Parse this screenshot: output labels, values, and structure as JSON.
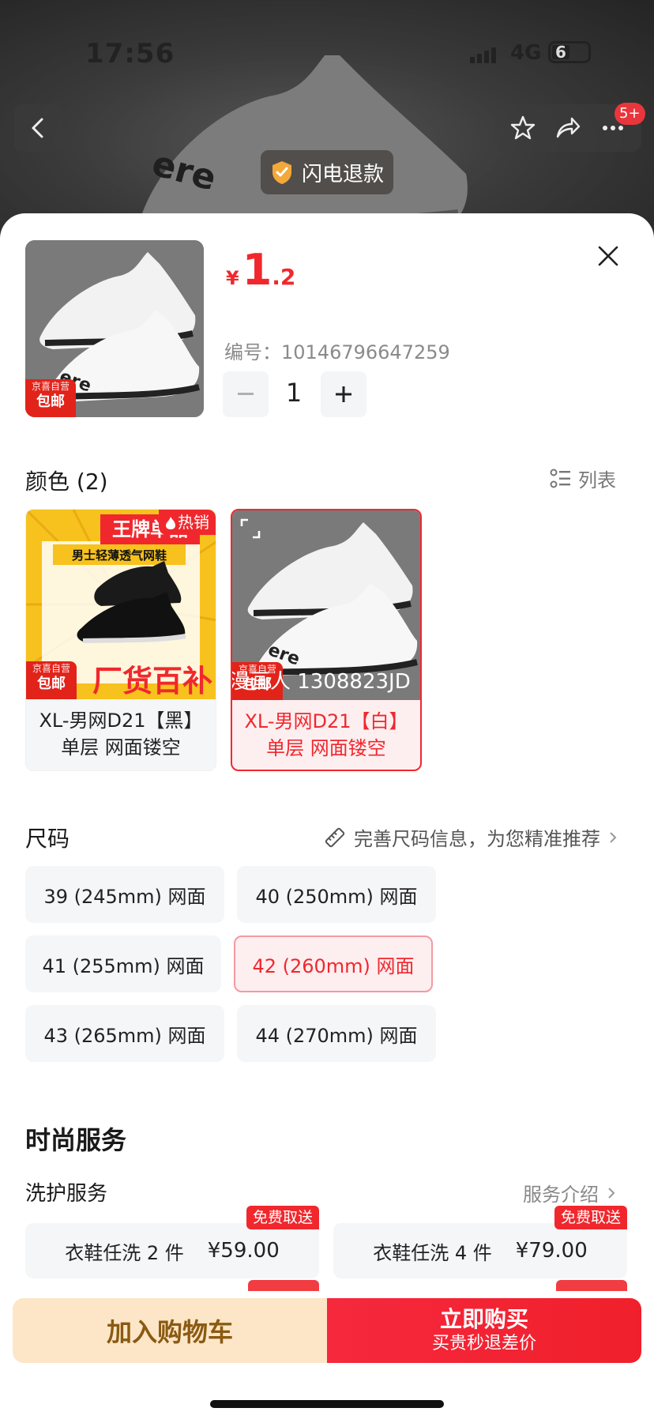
{
  "status_bar": {
    "time": "17:56",
    "network": "4G",
    "battery": "6"
  },
  "top_nav": {
    "cart_badge": "5+",
    "refund_label": "闪电退款"
  },
  "product": {
    "price_currency": "¥",
    "price_int": "1",
    "price_dec": ".2",
    "sku_label": "编号：10146796647259",
    "quantity": "1",
    "thumb_badge_top": "京喜自营",
    "thumb_badge_bottom": "包邮"
  },
  "color_section": {
    "title": "颜色 (2)",
    "list_toggle": "列表",
    "options": [
      {
        "label_line1": "XL-男网D21【黑】",
        "label_line2": "单层 网面镂空",
        "hot_tag": "热销",
        "badge_top": "京喜自营",
        "badge_bottom": "包邮",
        "banner_top": "王牌单品",
        "banner_sub": "男士轻薄透气网鞋",
        "banner_bottom": "厂货百补",
        "selected": false
      },
      {
        "label_line1": "XL-男网D21【白】",
        "label_line2": "单层 网面镂空",
        "badge_top": "京喜自营",
        "badge_bottom": "包邮",
        "watermark": "漫画人 1308823JD",
        "selected": true
      }
    ]
  },
  "size_section": {
    "title": "尺码",
    "hint": "完善尺码信息，为您精准推荐",
    "options": [
      "39 (245mm) 网面",
      "40 (250mm) 网面",
      "41 (255mm) 网面",
      "42 (260mm) 网面",
      "43 (265mm) 网面",
      "44 (270mm) 网面"
    ],
    "selected": "42 (260mm) 网面"
  },
  "service_section": {
    "title": "时尚服务",
    "subtitle": "洗护服务",
    "intro_link": "服务介绍",
    "cards": [
      {
        "name": "衣鞋任洗 2 件",
        "price": "¥59.00",
        "tag": "免费取送"
      },
      {
        "name": "衣鞋任洗 4 件",
        "price": "¥79.00",
        "tag": "免费取送"
      }
    ]
  },
  "bottom_bar": {
    "add_to_cart": "加入购物车",
    "buy_now": "立即购买",
    "buy_now_sub": "买贵秒退差价"
  },
  "colors": {
    "accent": "#f0282d",
    "cart_bg": "#fde6c8",
    "cart_text": "#8a5a12"
  }
}
